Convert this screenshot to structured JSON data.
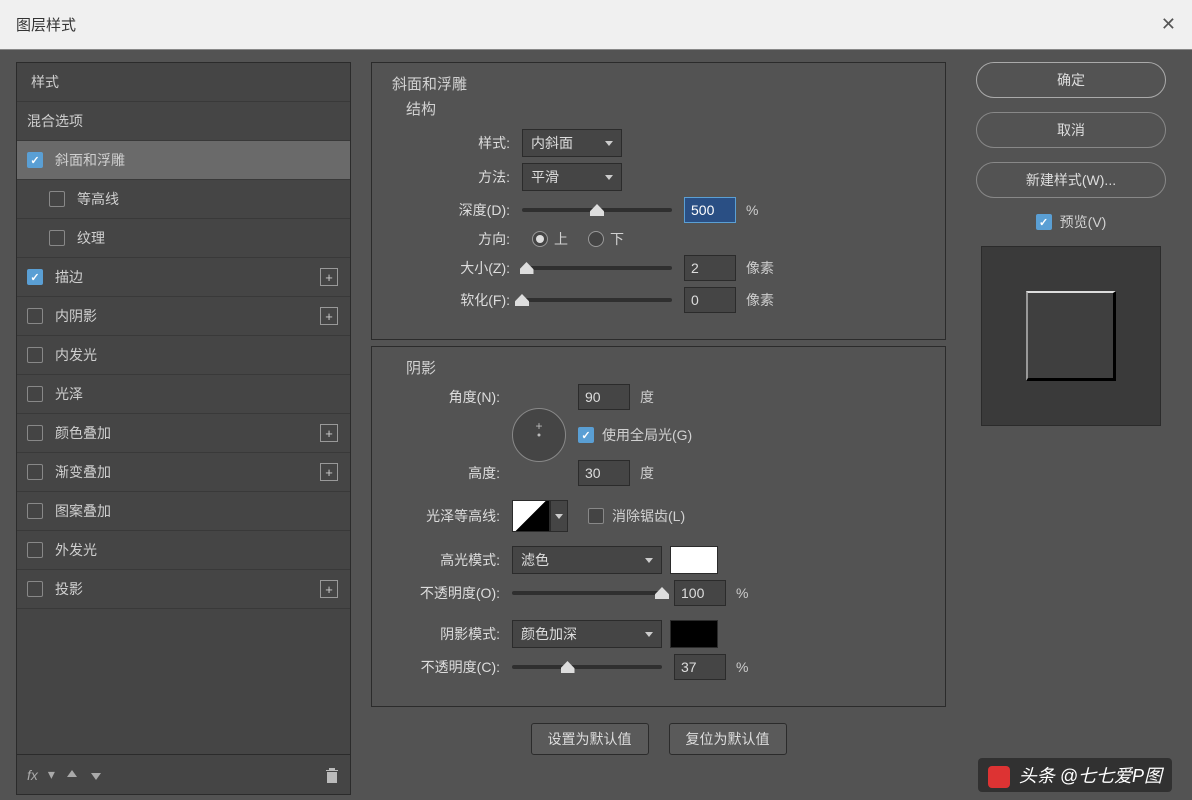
{
  "window": {
    "title": "图层样式"
  },
  "sidebar": {
    "header": "样式",
    "blend": "混合选项",
    "items": [
      {
        "label": "斜面和浮雕",
        "checked": true,
        "indent": false,
        "plus": false,
        "sel": true
      },
      {
        "label": "等高线",
        "checked": false,
        "indent": true,
        "plus": false,
        "sel": false
      },
      {
        "label": "纹理",
        "checked": false,
        "indent": true,
        "plus": false,
        "sel": false
      },
      {
        "label": "描边",
        "checked": true,
        "indent": false,
        "plus": true,
        "sel": false
      },
      {
        "label": "内阴影",
        "checked": false,
        "indent": false,
        "plus": true,
        "sel": false
      },
      {
        "label": "内发光",
        "checked": false,
        "indent": false,
        "plus": false,
        "sel": false
      },
      {
        "label": "光泽",
        "checked": false,
        "indent": false,
        "plus": false,
        "sel": false
      },
      {
        "label": "颜色叠加",
        "checked": false,
        "indent": false,
        "plus": true,
        "sel": false
      },
      {
        "label": "渐变叠加",
        "checked": false,
        "indent": false,
        "plus": true,
        "sel": false
      },
      {
        "label": "图案叠加",
        "checked": false,
        "indent": false,
        "plus": false,
        "sel": false
      },
      {
        "label": "外发光",
        "checked": false,
        "indent": false,
        "plus": false,
        "sel": false
      },
      {
        "label": "投影",
        "checked": false,
        "indent": false,
        "plus": true,
        "sel": false
      }
    ],
    "fx": "fx"
  },
  "panel": {
    "bevel": {
      "title": "斜面和浮雕",
      "struct": "结构",
      "style_lbl": "样式:",
      "style_val": "内斜面",
      "method_lbl": "方法:",
      "method_val": "平滑",
      "depth_lbl": "深度(D):",
      "depth_val": "500",
      "depth_unit": "%",
      "dir_lbl": "方向:",
      "dir_up": "上",
      "dir_down": "下",
      "size_lbl": "大小(Z):",
      "size_val": "2",
      "size_unit": "像素",
      "soften_lbl": "软化(F):",
      "soften_val": "0",
      "soften_unit": "像素"
    },
    "shadow": {
      "title": "阴影",
      "angle_lbl": "角度(N):",
      "angle_val": "90",
      "angle_unit": "度",
      "global": "使用全局光(G)",
      "alt_lbl": "高度:",
      "alt_val": "30",
      "alt_unit": "度",
      "contour_lbl": "光泽等高线:",
      "antialias": "消除锯齿(L)",
      "hi_mode_lbl": "高光模式:",
      "hi_mode_val": "滤色",
      "hi_opacity_lbl": "不透明度(O):",
      "hi_opacity_val": "100",
      "pct": "%",
      "sh_mode_lbl": "阴影模式:",
      "sh_mode_val": "颜色加深",
      "sh_opacity_lbl": "不透明度(C):",
      "sh_opacity_val": "37"
    },
    "buttons": {
      "default": "设置为默认值",
      "reset": "复位为默认值"
    }
  },
  "right": {
    "ok": "确定",
    "cancel": "取消",
    "new_style": "新建样式(W)...",
    "preview": "预览(V)"
  },
  "watermark": "头条 @七七爱P图",
  "colors": {
    "highlight": "#ffffff",
    "shadow": "#000000"
  }
}
